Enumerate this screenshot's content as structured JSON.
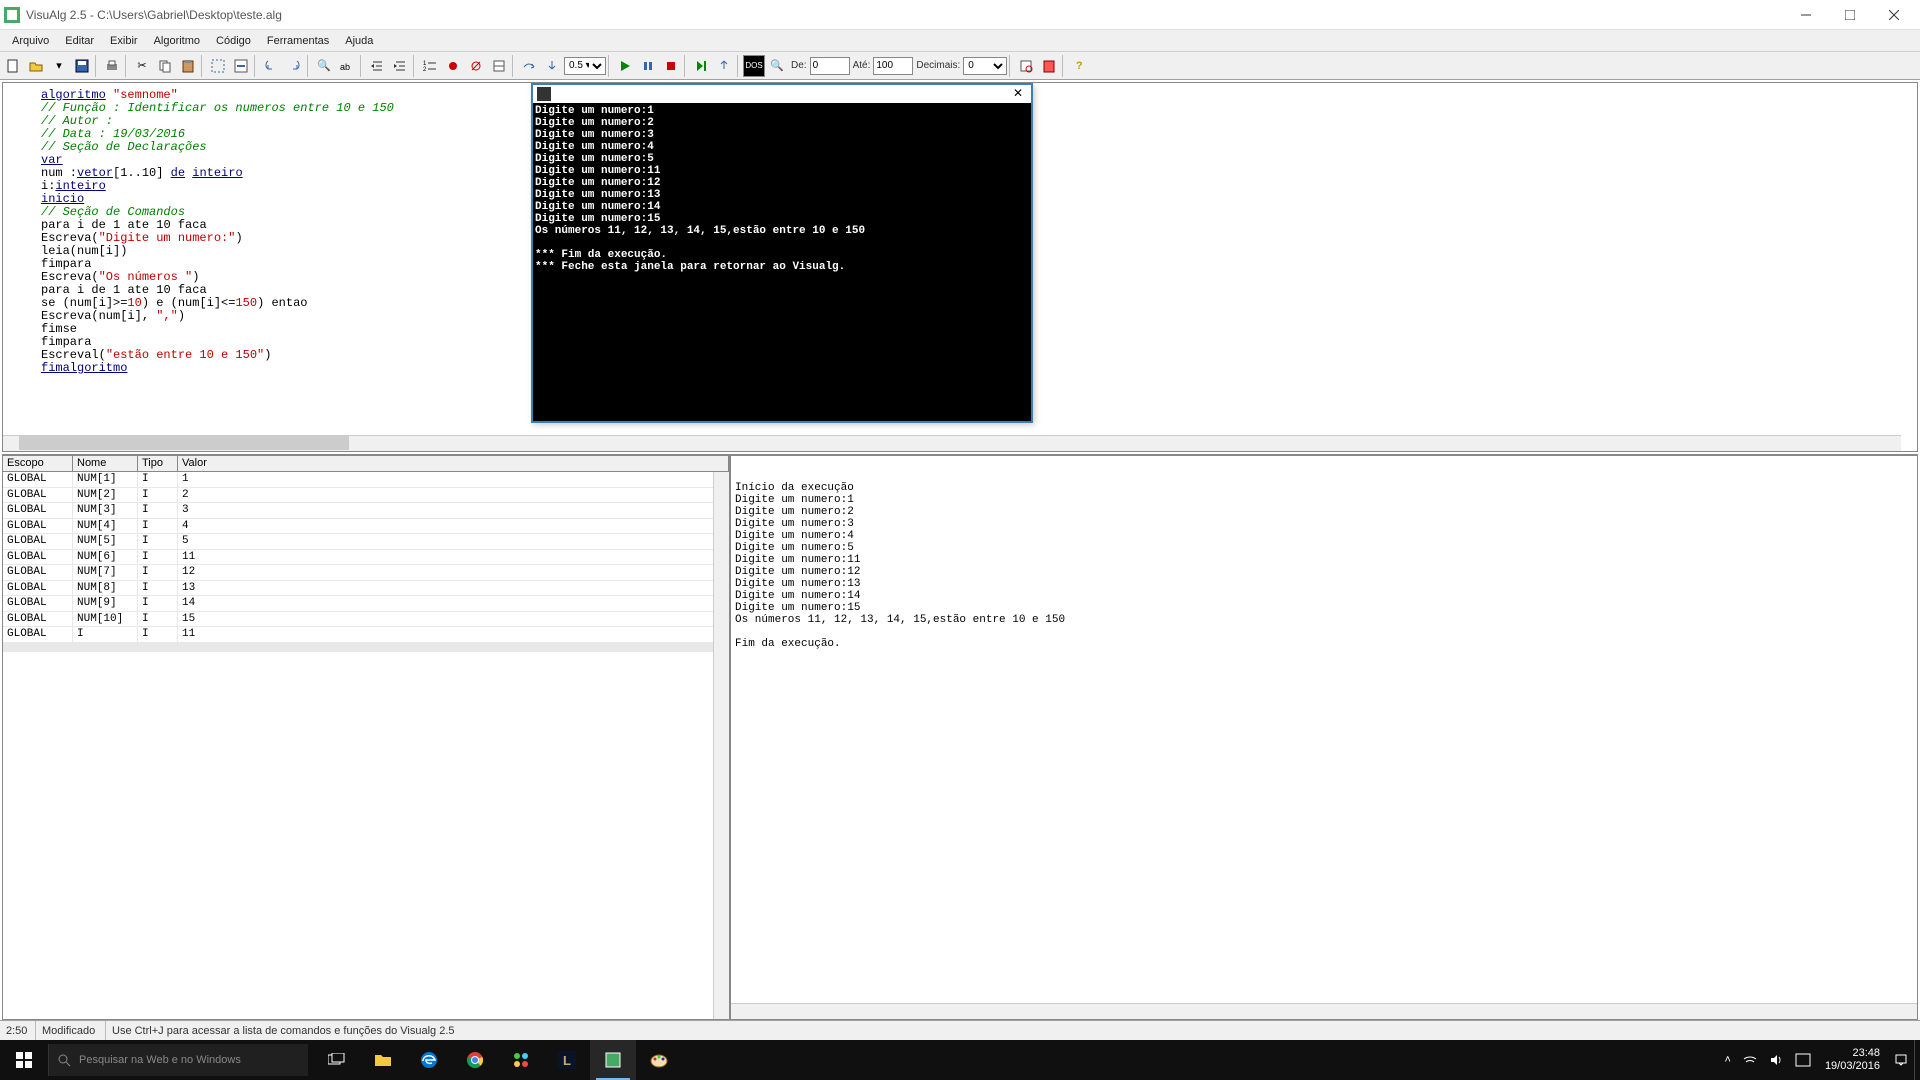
{
  "window": {
    "title": "VisuAlg 2.5 - C:\\Users\\Gabriel\\Desktop\\teste.alg"
  },
  "menu": [
    "Arquivo",
    "Editar",
    "Exibir",
    "Algoritmo",
    "Código",
    "Ferramentas",
    "Ajuda"
  ],
  "toolbar": {
    "de_label": "De:",
    "de_value": "0",
    "ate_label": "Até:",
    "ate_value": "100",
    "decimais_label": "Decimais:",
    "decimais_value": "0",
    "zoom": "0.5 ▾"
  },
  "code_tokens": [
    [
      {
        "t": "algoritmo",
        "c": "kw"
      },
      {
        "t": " "
      },
      {
        "t": "\"semnome\"",
        "c": "str"
      }
    ],
    [
      {
        "t": "// Função : Identificar os numeros entre 10 e 150",
        "c": "cmt"
      }
    ],
    [
      {
        "t": "// Autor :",
        "c": "cmt"
      }
    ],
    [
      {
        "t": "// Data : 19/03/2016",
        "c": "cmt"
      }
    ],
    [
      {
        "t": "// Seção de Declarações",
        "c": "cmt"
      }
    ],
    [
      {
        "t": "var",
        "c": "kw"
      }
    ],
    [
      {
        "t": "num :"
      },
      {
        "t": "vetor",
        "c": "kw"
      },
      {
        "t": "[1..10] "
      },
      {
        "t": "de",
        "c": "kw"
      },
      {
        "t": " "
      },
      {
        "t": "inteiro",
        "c": "kw"
      }
    ],
    [
      {
        "t": "i:"
      },
      {
        "t": "inteiro",
        "c": "kw"
      }
    ],
    [
      {
        "t": "inicio",
        "c": "kw"
      }
    ],
    [
      {
        "t": "// Seção de Comandos",
        "c": "cmt"
      }
    ],
    [
      {
        "t": "para"
      },
      {
        "t": " i "
      },
      {
        "t": "de"
      },
      {
        "t": " 1 "
      },
      {
        "t": "ate"
      },
      {
        "t": " 10 "
      },
      {
        "t": "faca"
      }
    ],
    [
      {
        "t": "Escreva("
      },
      {
        "t": "\"Digite um numero:\"",
        "c": "str"
      },
      {
        "t": ")"
      }
    ],
    [
      {
        "t": "leia(num[i])"
      }
    ],
    [
      {
        "t": "fimpara"
      }
    ],
    [
      {
        "t": "Escreva("
      },
      {
        "t": "\"Os números \"",
        "c": "str"
      },
      {
        "t": ")"
      }
    ],
    [
      {
        "t": "para"
      },
      {
        "t": " i "
      },
      {
        "t": "de"
      },
      {
        "t": " 1 "
      },
      {
        "t": "ate"
      },
      {
        "t": " 10 "
      },
      {
        "t": "faca"
      }
    ],
    [
      {
        "t": "se"
      },
      {
        "t": " (num[i]>="
      },
      {
        "t": "10",
        "c": "str"
      },
      {
        "t": ") "
      },
      {
        "t": "e"
      },
      {
        "t": " (num[i]<="
      },
      {
        "t": "150",
        "c": "str"
      },
      {
        "t": ") "
      },
      {
        "t": "entao"
      }
    ],
    [
      {
        "t": "Escreva(num[i], "
      },
      {
        "t": "\",\"",
        "c": "str"
      },
      {
        "t": ")"
      }
    ],
    [
      {
        "t": "fimse"
      }
    ],
    [
      {
        "t": "fimpara"
      }
    ],
    [
      {
        "t": "Escreval("
      },
      {
        "t": "\"estão entre 10 e 150\"",
        "c": "str"
      },
      {
        "t": ")"
      }
    ],
    [
      {
        "t": "fimalgoritmo",
        "c": "kw"
      }
    ]
  ],
  "console_lines": [
    "Digite um numero:1",
    "Digite um numero:2",
    "Digite um numero:3",
    "Digite um numero:4",
    "Digite um numero:5",
    "Digite um numero:11",
    "Digite um numero:12",
    "Digite um numero:13",
    "Digite um numero:14",
    "Digite um numero:15",
    "Os números 11, 12, 13, 14, 15,estão entre 10 e 150",
    "",
    "*** Fim da execução.",
    "*** Feche esta janela para retornar ao Visualg."
  ],
  "vars_headers": {
    "escopo": "Escopo",
    "nome": "Nome",
    "tipo": "Tipo",
    "valor": "Valor"
  },
  "vars": [
    {
      "escopo": "GLOBAL",
      "nome": "NUM[1]",
      "tipo": "I",
      "valor": "1"
    },
    {
      "escopo": "GLOBAL",
      "nome": "NUM[2]",
      "tipo": "I",
      "valor": "2"
    },
    {
      "escopo": "GLOBAL",
      "nome": "NUM[3]",
      "tipo": "I",
      "valor": "3"
    },
    {
      "escopo": "GLOBAL",
      "nome": "NUM[4]",
      "tipo": "I",
      "valor": "4"
    },
    {
      "escopo": "GLOBAL",
      "nome": "NUM[5]",
      "tipo": "I",
      "valor": "5"
    },
    {
      "escopo": "GLOBAL",
      "nome": "NUM[6]",
      "tipo": "I",
      "valor": "11"
    },
    {
      "escopo": "GLOBAL",
      "nome": "NUM[7]",
      "tipo": "I",
      "valor": "12"
    },
    {
      "escopo": "GLOBAL",
      "nome": "NUM[8]",
      "tipo": "I",
      "valor": "13"
    },
    {
      "escopo": "GLOBAL",
      "nome": "NUM[9]",
      "tipo": "I",
      "valor": "14"
    },
    {
      "escopo": "GLOBAL",
      "nome": "NUM[10]",
      "tipo": "I",
      "valor": "15"
    },
    {
      "escopo": "GLOBAL",
      "nome": "I",
      "tipo": "I",
      "valor": "11"
    }
  ],
  "log_lines": [
    "Início da execução",
    "Digite um numero:1",
    "Digite um numero:2",
    "Digite um numero:3",
    "Digite um numero:4",
    "Digite um numero:5",
    "Digite um numero:11",
    "Digite um numero:12",
    "Digite um numero:13",
    "Digite um numero:14",
    "Digite um numero:15",
    "Os números 11, 12, 13, 14, 15,estão entre 10 e 150",
    "",
    "Fim da execução."
  ],
  "status": {
    "pos": "2:50",
    "mod": "Modificado",
    "hint": "Use Ctrl+J para acessar a lista de comandos e funções do Visualg 2.5"
  },
  "taskbar": {
    "search_placeholder": "Pesquisar na Web e no Windows",
    "time": "23:48",
    "date": "19/03/2016"
  }
}
